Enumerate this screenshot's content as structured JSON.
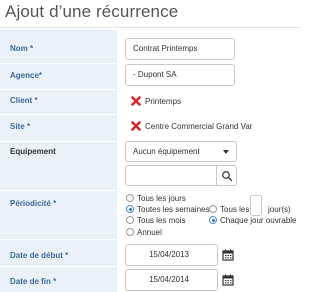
{
  "title": "Ajout d’une récurrence",
  "fields": {
    "nom": {
      "label": "Nom",
      "req": "*",
      "value": "Contrat Printemps"
    },
    "agence": {
      "label": "Agence",
      "req": "*",
      "value": "- Dupont SA"
    },
    "client": {
      "label": "Client",
      "req": "*",
      "value": "Printemps"
    },
    "site": {
      "label": "Site",
      "req": "*",
      "value": "Centre Commercial Grand Var"
    },
    "equipement": {
      "label": "Equipement",
      "select_value": "Aucun équipement",
      "search_value": ""
    },
    "periodicite": {
      "label": "Périodicité",
      "req": "*",
      "options": {
        "tous_jours": "Tous les jours",
        "toutes_semaines": "Toutes les semaines",
        "tous_mois": "Tous les mois",
        "annuel": "Annuel",
        "tous_les": "Tous les",
        "jours": "jour(s)",
        "ouvrable": "Chaque jour ouvrable"
      },
      "selected_period": "Toutes les semaines",
      "selected_day": "Chaque jour ouvrable"
    },
    "date_debut": {
      "label": "Date de début",
      "req": "*",
      "value": "15/04/2013"
    },
    "date_fin": {
      "label": "Date de fin",
      "req": "*",
      "value": "15/04/2014"
    }
  },
  "icons": {
    "remove": "red-x-icon",
    "search": "magnifier-icon",
    "calendar": "calendar-icon",
    "dropdown": "chevron-down-icon"
  },
  "colors": {
    "label_blue": "#3e6aa0",
    "label_bg": "#eaf1f9",
    "remove_red": "#d9262b"
  }
}
